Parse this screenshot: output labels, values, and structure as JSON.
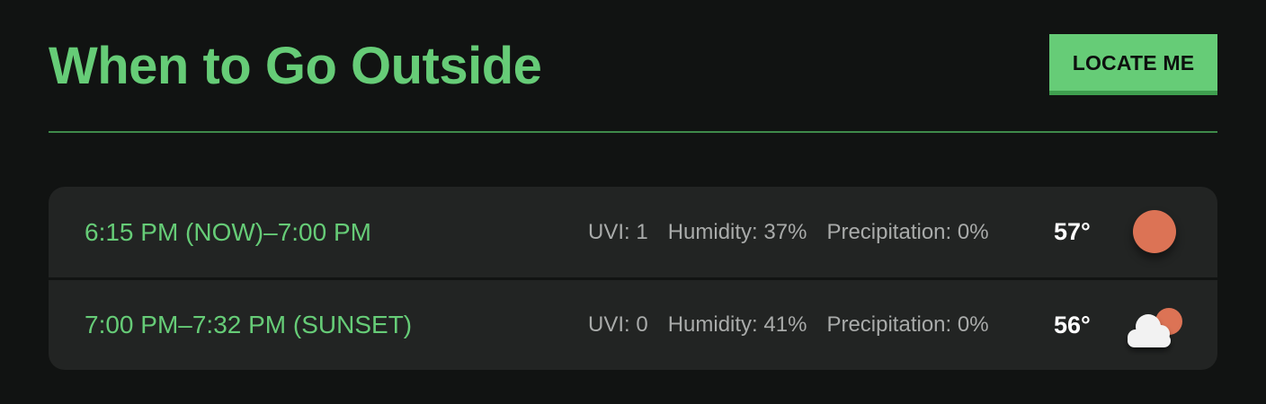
{
  "header": {
    "title": "When to Go Outside",
    "locate_button_label": "LOCATE ME"
  },
  "colors": {
    "accent": "#66cc77",
    "background": "#111312",
    "card": "#222423",
    "sun": "#dc7355",
    "cloud": "#f2f2f2"
  },
  "forecast": [
    {
      "time_range": "6:15 PM (NOW)–7:00 PM",
      "uvi": "UVI: 1",
      "humidity": "Humidity: 37%",
      "precipitation": "Precipitation: 0%",
      "temperature": "57°",
      "icon": "sun-icon"
    },
    {
      "time_range": "7:00 PM–7:32 PM (SUNSET)",
      "uvi": "UVI: 0",
      "humidity": "Humidity: 41%",
      "precipitation": "Precipitation: 0%",
      "temperature": "56°",
      "icon": "partly-cloudy-icon"
    }
  ]
}
